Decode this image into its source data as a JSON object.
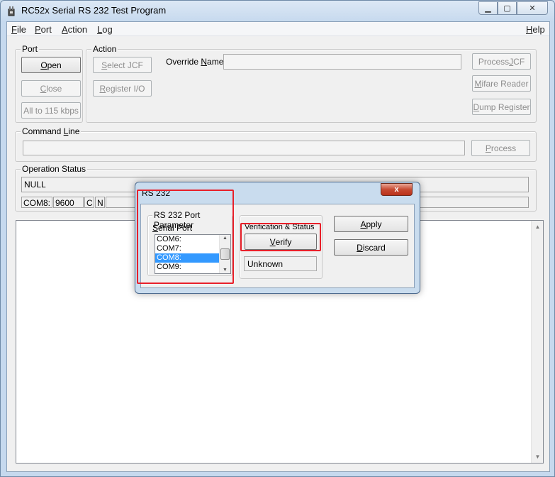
{
  "window": {
    "title": "RC52x Serial RS 232 Test Program",
    "controls": {
      "minimize": "▁",
      "maximize": "▢",
      "close": "✕"
    }
  },
  "menu": {
    "file": {
      "mnemonic": "F",
      "rest": "ile"
    },
    "port": {
      "mnemonic": "P",
      "rest": "ort"
    },
    "action": {
      "mnemonic": "A",
      "rest": "ction"
    },
    "log": {
      "mnemonic": "L",
      "rest": "og"
    },
    "help": {
      "mnemonic": "H",
      "rest": "elp"
    }
  },
  "port_group": {
    "label": "Port",
    "open": {
      "mnemonic": "O",
      "rest": "pen"
    },
    "close": {
      "mnemonic": "C",
      "rest": "lose"
    },
    "all_to_115": "All to 115 kbps"
  },
  "action_group": {
    "label": "Action",
    "select_jcf": {
      "mnemonic": "S",
      "rest": "elect JCF"
    },
    "register_io": {
      "mnemonic": "R",
      "rest": "egister I/O"
    },
    "override_name_label": {
      "before": "Override ",
      "mnemonic": "N",
      "rest": "ame:"
    },
    "override_name_value": ""
  },
  "right_buttons": {
    "process_jcf": {
      "before": "Process ",
      "mnemonic": "J",
      "rest": "CF"
    },
    "mifare_reader": {
      "mnemonic": "M",
      "rest": "ifare Reader"
    },
    "dump_register": {
      "mnemonic": "D",
      "rest": "ump Register"
    }
  },
  "command_line": {
    "label": {
      "before": "Command ",
      "mnemonic": "L",
      "rest": "ine"
    },
    "value": "",
    "process": {
      "mnemonic": "P",
      "rest": "rocess"
    }
  },
  "operation_status": {
    "label": "Operation Status",
    "status": "NULL",
    "port": "COM8:",
    "baud": "9600",
    "flag1": "C",
    "flag2": "N"
  },
  "dialog": {
    "title": "RS 232",
    "close_glyph": "x",
    "port_params_label": "RS 232 Port Parameter",
    "serial_port_label": {
      "mnemonic": "S",
      "rest": "erial Port"
    },
    "serial_ports": [
      "COM6:",
      "COM7:",
      "COM8:",
      "COM9:"
    ],
    "selected_port": "COM8:",
    "verification_label": "Verification & Status",
    "verify": {
      "mnemonic": "V",
      "rest": "erify"
    },
    "status": "Unknown",
    "apply": {
      "mnemonic": "A",
      "rest": "pply"
    },
    "discard": {
      "mnemonic": "D",
      "rest": "iscard"
    }
  },
  "colors": {
    "highlight": "#e8202a",
    "selection": "#3399ff",
    "close_button": "#c74a32"
  }
}
